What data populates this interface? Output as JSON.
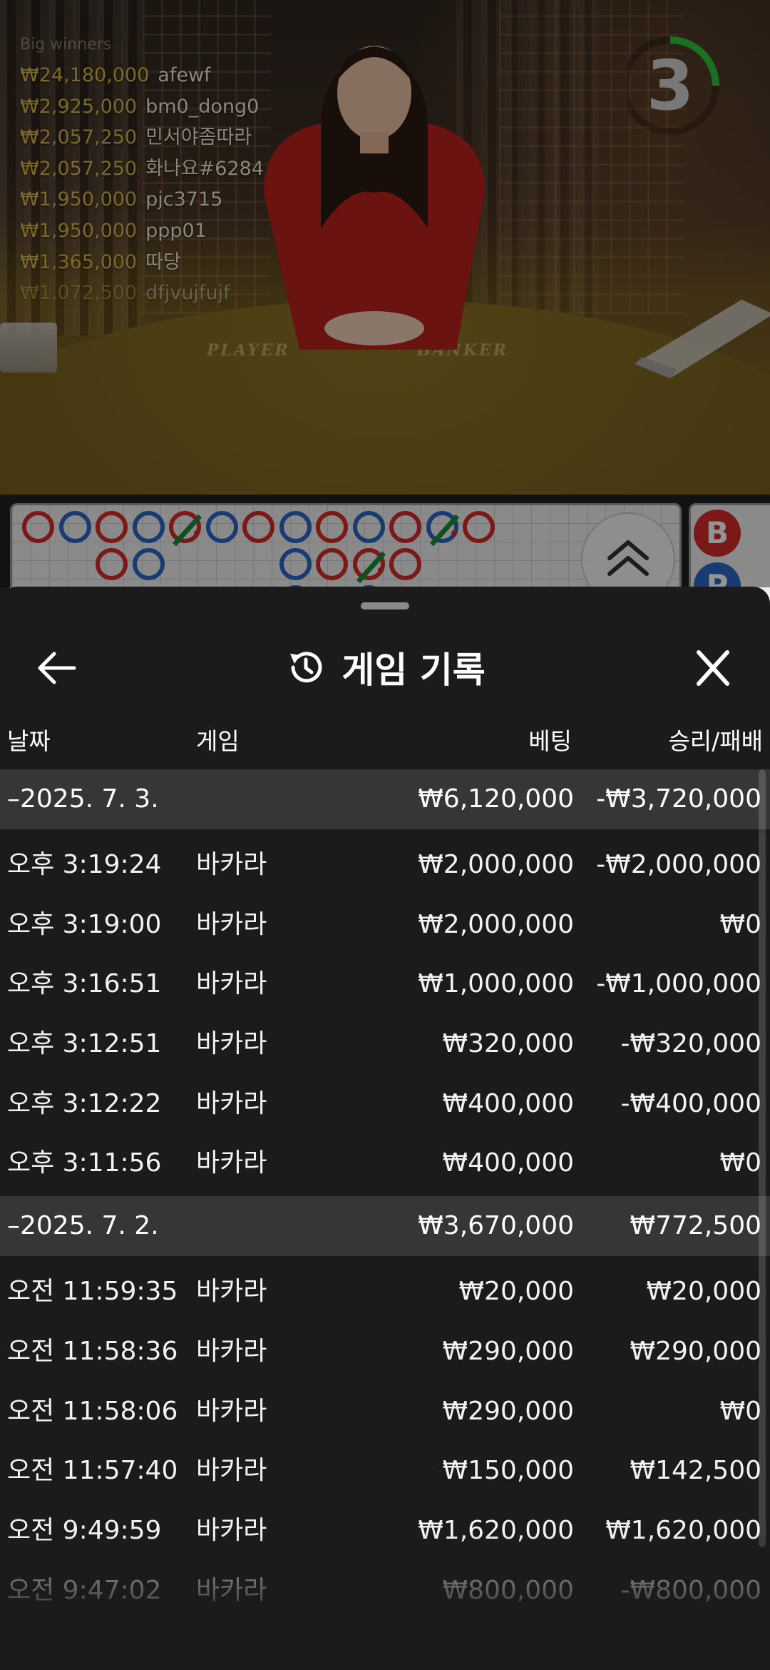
{
  "winners": {
    "header": "Big winners",
    "list": [
      {
        "amount": "₩24,180,000",
        "name": "afewf"
      },
      {
        "amount": "₩2,925,000",
        "name": "bm0_dong0"
      },
      {
        "amount": "₩2,057,250",
        "name": "민서야좀따라"
      },
      {
        "amount": "₩2,057,250",
        "name": "화나요#6284"
      },
      {
        "amount": "₩1,950,000",
        "name": "pjc3715"
      },
      {
        "amount": "₩1,950,000",
        "name": "ppp01"
      },
      {
        "amount": "₩1,365,000",
        "name": "따당"
      },
      {
        "amount": "₩1,072,500",
        "name": "dfjvujfujf"
      }
    ]
  },
  "table_labels": {
    "player": "PLAYER",
    "banker": "BANKER"
  },
  "countdown": {
    "value": "3",
    "ring_color": "#2fbf3a",
    "remaining_fraction": 0.25
  },
  "road": {
    "badges": [
      {
        "letter": "B",
        "color": "#d42b2b"
      },
      {
        "letter": "P",
        "color": "#2a68c4"
      }
    ]
  },
  "colors": {
    "banker": "#d42b2b",
    "player": "#2a68c4",
    "tie": "#1a8a3a",
    "sheet_bg": "#1b1b1b",
    "date_row_bg": "#363636"
  },
  "icons": {
    "back": "arrow-left-icon",
    "history": "history-icon",
    "close": "close-icon",
    "expand": "chevron-double-up-icon"
  },
  "sheet": {
    "title": "게임 기록",
    "columns": {
      "date": "날짜",
      "game": "게임",
      "bet": "베팅",
      "result": "승리/패배"
    },
    "groups": [
      {
        "date": "–2025. 7. 3.",
        "total_bet": "₩6,120,000",
        "total_result": "-₩3,720,000",
        "records": [
          {
            "time": "오후 3:19:24",
            "game": "바카라",
            "bet": "₩2,000,000",
            "result": "-₩2,000,000"
          },
          {
            "time": "오후 3:19:00",
            "game": "바카라",
            "bet": "₩2,000,000",
            "result": "₩0"
          },
          {
            "time": "오후 3:16:51",
            "game": "바카라",
            "bet": "₩1,000,000",
            "result": "-₩1,000,000"
          },
          {
            "time": "오후 3:12:51",
            "game": "바카라",
            "bet": "₩320,000",
            "result": "-₩320,000"
          },
          {
            "time": "오후 3:12:22",
            "game": "바카라",
            "bet": "₩400,000",
            "result": "-₩400,000"
          },
          {
            "time": "오후 3:11:56",
            "game": "바카라",
            "bet": "₩400,000",
            "result": "₩0"
          }
        ]
      },
      {
        "date": "–2025. 7. 2.",
        "total_bet": "₩3,670,000",
        "total_result": "₩772,500",
        "records": [
          {
            "time": "오전 11:59:35",
            "game": "바카라",
            "bet": "₩20,000",
            "result": "₩20,000"
          },
          {
            "time": "오전 11:58:36",
            "game": "바카라",
            "bet": "₩290,000",
            "result": "₩290,000"
          },
          {
            "time": "오전 11:58:06",
            "game": "바카라",
            "bet": "₩290,000",
            "result": "₩0"
          },
          {
            "time": "오전 11:57:40",
            "game": "바카라",
            "bet": "₩150,000",
            "result": "₩142,500"
          },
          {
            "time": "오전 9:49:59",
            "game": "바카라",
            "bet": "₩1,620,000",
            "result": "₩1,620,000"
          },
          {
            "time": "오전 9:47:02",
            "game": "바카라",
            "bet": "₩800,000",
            "result": "-₩800,000"
          }
        ]
      }
    ]
  }
}
